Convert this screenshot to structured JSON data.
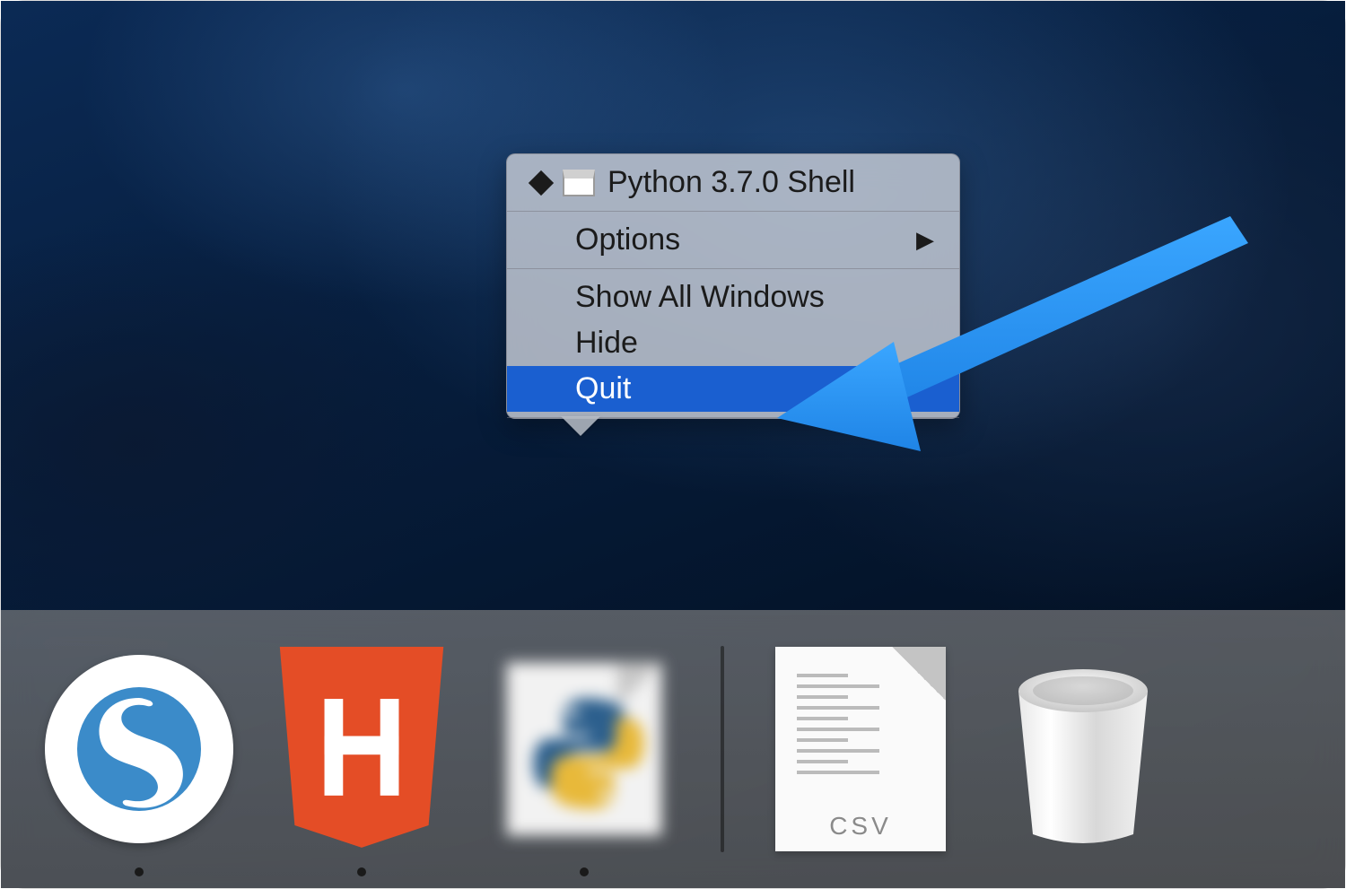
{
  "menu": {
    "window_title": "Python 3.7.0 Shell",
    "options_label": "Options",
    "show_all_label": "Show All Windows",
    "hide_label": "Hide",
    "quit_label": "Quit"
  },
  "dock": {
    "csv_label": "CSV",
    "items": [
      {
        "name": "simplenote-app",
        "running": true
      },
      {
        "name": "html5-app",
        "running": true
      },
      {
        "name": "python-idle-app",
        "running": true
      },
      {
        "name": "csv-document",
        "running": false
      },
      {
        "name": "trash",
        "running": false
      }
    ]
  },
  "colors": {
    "menu_highlight": "#1a5fd0",
    "annotation_arrow": "#2b9bff"
  }
}
